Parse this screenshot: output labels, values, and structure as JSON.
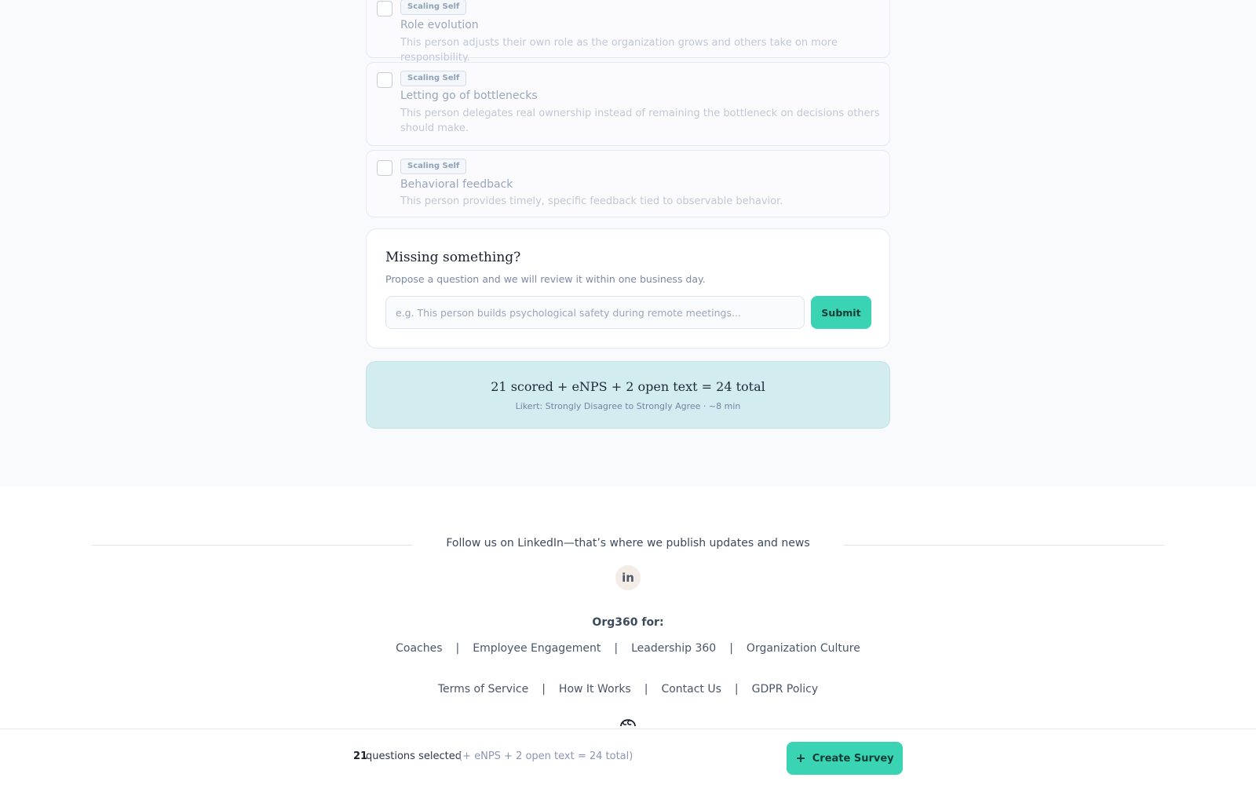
{
  "questions": [
    {
      "tag": "Scaling Self",
      "title": "Role evolution",
      "description": "This person adjusts their own role as the organization grows and others take on more responsibility."
    },
    {
      "tag": "Scaling Self",
      "title": "Letting go of bottlenecks",
      "description": "This person delegates real ownership instead of remaining the bottleneck on decisions others should make."
    },
    {
      "tag": "Scaling Self",
      "title": "Behavioral feedback",
      "description": "This person provides timely, specific feedback tied to observable behavior."
    }
  ],
  "missing": {
    "title": "Missing something?",
    "subtitle": "Propose a question and we will review it within one business day.",
    "placeholder": "e.g. This person builds psychological safety during remote meetings...",
    "submit_label": "Submit"
  },
  "summary": {
    "total_line": "21 scored + eNPS + 2 open text = 24 total",
    "detail_line": "Likert: Strongly Disagree to Strongly Agree · ~8 min"
  },
  "footer": {
    "follow_text": "Follow us on LinkedIn—that’s where we publish updates and news",
    "linkedin_label": "in",
    "org_title": "Org360 for:",
    "audience_links": [
      "Coaches",
      "Employee Engagement",
      "Leadership 360",
      "Organization Culture"
    ],
    "legal_links": [
      "Terms of Service",
      "How It Works",
      "Contact Us",
      "GDPR Policy"
    ],
    "separator": "|"
  },
  "bottom_bar": {
    "selected_count": "21",
    "selected_label": "questions selected",
    "selected_extra": "(+ eNPS + 2 open text = 24 total)",
    "create_label": "Create Survey"
  },
  "colors": {
    "accent": "#3ad4b5",
    "summary_bg": "#d3ecef",
    "page_bg": "#f9fafc"
  }
}
